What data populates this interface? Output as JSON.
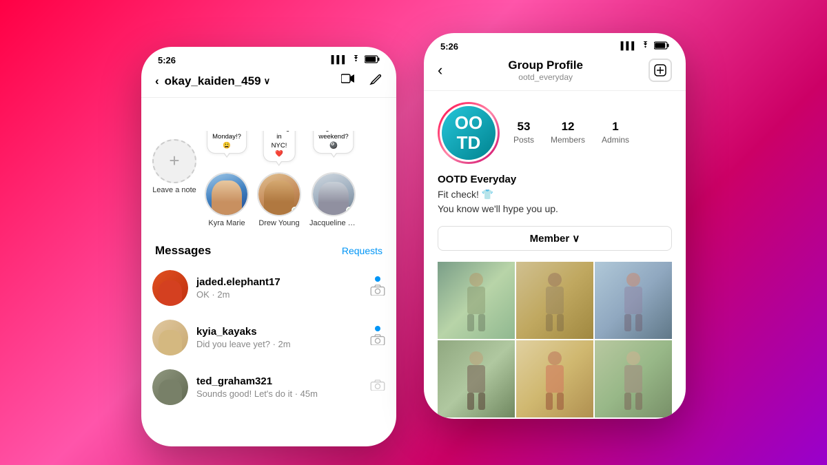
{
  "page": {
    "background": "gradient pink-purple"
  },
  "phoneLeft": {
    "statusBar": {
      "time": "5:26",
      "signal": "▌▌▌",
      "wifi": "wifi",
      "battery": "battery"
    },
    "header": {
      "backLabel": "<",
      "username": "okay_kaiden_459",
      "chevron": "∨",
      "videoIcon": "📹",
      "editIcon": "✏️"
    },
    "stories": [
      {
        "id": "add",
        "label": "Leave a note",
        "hasAdd": true,
        "note": null,
        "hasOnline": false
      },
      {
        "id": "kyra",
        "label": "Kyra Marie",
        "hasAdd": false,
        "note": "Why is tomorrow Monday!? 😩",
        "hasOnline": false
      },
      {
        "id": "drew",
        "label": "Drew Young",
        "hasAdd": false,
        "note": "Finally landing in NYC! ❤️",
        "hasOnline": true
      },
      {
        "id": "jacq",
        "label": "Jacqueline Lam",
        "hasAdd": false,
        "note": "Game night this weekend? 🎱",
        "hasOnline": true
      }
    ],
    "messagesSection": {
      "title": "Messages",
      "requestsLabel": "Requests",
      "messages": [
        {
          "username": "jaded.elephant17",
          "preview": "OK · 2m",
          "hasUnread": true,
          "hasCamera": true
        },
        {
          "username": "kyia_kayaks",
          "preview": "Did you leave yet? · 2m",
          "hasUnread": true,
          "hasCamera": true
        },
        {
          "username": "ted_graham321",
          "preview": "Sounds good! Let's do it · 45m",
          "hasUnread": false,
          "hasCamera": true
        }
      ]
    }
  },
  "phoneRight": {
    "statusBar": {
      "time": "5:26",
      "signal": "▌▌▌",
      "wifi": "wifi",
      "battery": "battery"
    },
    "header": {
      "backLabel": "<",
      "title": "Group Profile",
      "subtitle": "ootd_everyday",
      "addIcon": "+"
    },
    "profile": {
      "avatarText": "OO\nTD",
      "stats": [
        {
          "number": "53",
          "label": "Posts"
        },
        {
          "number": "12",
          "label": "Members"
        },
        {
          "number": "1",
          "label": "Admins"
        }
      ],
      "name": "OOTD Everyday",
      "bio": "Fit check! 👕\nYou know we'll hype you up.",
      "memberButton": "Member ∨"
    },
    "photos": [
      {
        "id": 1,
        "class": "photo-1"
      },
      {
        "id": 2,
        "class": "photo-2"
      },
      {
        "id": 3,
        "class": "photo-3"
      },
      {
        "id": 4,
        "class": "photo-4"
      },
      {
        "id": 5,
        "class": "photo-5"
      },
      {
        "id": 6,
        "class": "photo-6"
      }
    ]
  }
}
